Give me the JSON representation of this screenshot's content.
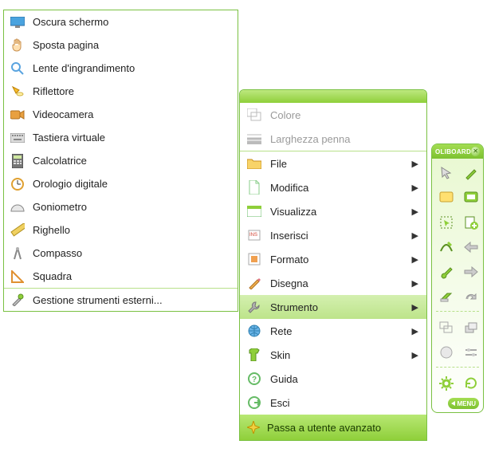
{
  "left_menu": {
    "items": [
      {
        "label": "Oscura schermo",
        "icon": "monitor"
      },
      {
        "label": "Sposta pagina",
        "icon": "hand"
      },
      {
        "label": "Lente d'ingrandimento",
        "icon": "magnifier"
      },
      {
        "label": "Riflettore",
        "icon": "spotlight"
      },
      {
        "label": "Videocamera",
        "icon": "camera"
      },
      {
        "label": "Tastiera virtuale",
        "icon": "keyboard"
      },
      {
        "label": "Calcolatrice",
        "icon": "calculator"
      },
      {
        "label": "Orologio digitale",
        "icon": "clock"
      },
      {
        "label": "Goniometro",
        "icon": "protractor"
      },
      {
        "label": "Righello",
        "icon": "ruler"
      },
      {
        "label": "Compasso",
        "icon": "compass"
      },
      {
        "label": "Squadra",
        "icon": "setsquare"
      }
    ],
    "footer": {
      "label": "Gestione strumenti esterni...",
      "icon": "tools"
    }
  },
  "mid_menu": {
    "disabled": [
      {
        "label": "Colore",
        "icon": "color-swatch"
      },
      {
        "label": "Larghezza penna",
        "icon": "line-width"
      }
    ],
    "items": [
      {
        "label": "File",
        "icon": "folder",
        "sub": true
      },
      {
        "label": "Modifica",
        "icon": "document",
        "sub": true
      },
      {
        "label": "Visualizza",
        "icon": "view",
        "sub": true
      },
      {
        "label": "Inserisci",
        "icon": "insert",
        "sub": true
      },
      {
        "label": "Formato",
        "icon": "format",
        "sub": true
      },
      {
        "label": "Disegna",
        "icon": "pencil",
        "sub": true
      },
      {
        "label": "Strumento",
        "icon": "wrench",
        "sub": true,
        "highlight": true
      },
      {
        "label": "Rete",
        "icon": "globe",
        "sub": true
      },
      {
        "label": "Skin",
        "icon": "tshirt",
        "sub": true
      },
      {
        "label": "Guida",
        "icon": "help",
        "sub": false
      },
      {
        "label": "Esci",
        "icon": "exit",
        "sub": false
      }
    ],
    "footer": {
      "label": "Passa a utente avanzato",
      "icon": "switch-user"
    }
  },
  "toolbar": {
    "brand": "OLIBOARD",
    "menu_label": "MENU",
    "buttons": [
      {
        "name": "mouse-tool-icon"
      },
      {
        "name": "pen-tool-icon"
      },
      {
        "name": "note-yellow-icon"
      },
      {
        "name": "note-green-icon"
      },
      {
        "name": "marquee-icon"
      },
      {
        "name": "add-page-icon"
      },
      {
        "name": "draw-line-icon"
      },
      {
        "name": "back-gray-icon"
      },
      {
        "name": "brush-icon"
      },
      {
        "name": "forward-gray-icon"
      },
      {
        "name": "eraser-icon"
      },
      {
        "name": "redo-gray-icon"
      },
      {
        "name": "layers-icon"
      },
      {
        "name": "shapes-stack-icon"
      },
      {
        "name": "circle-gray-icon"
      },
      {
        "name": "sliders-icon"
      },
      {
        "name": "gear-icon"
      },
      {
        "name": "refresh-icon"
      }
    ]
  }
}
